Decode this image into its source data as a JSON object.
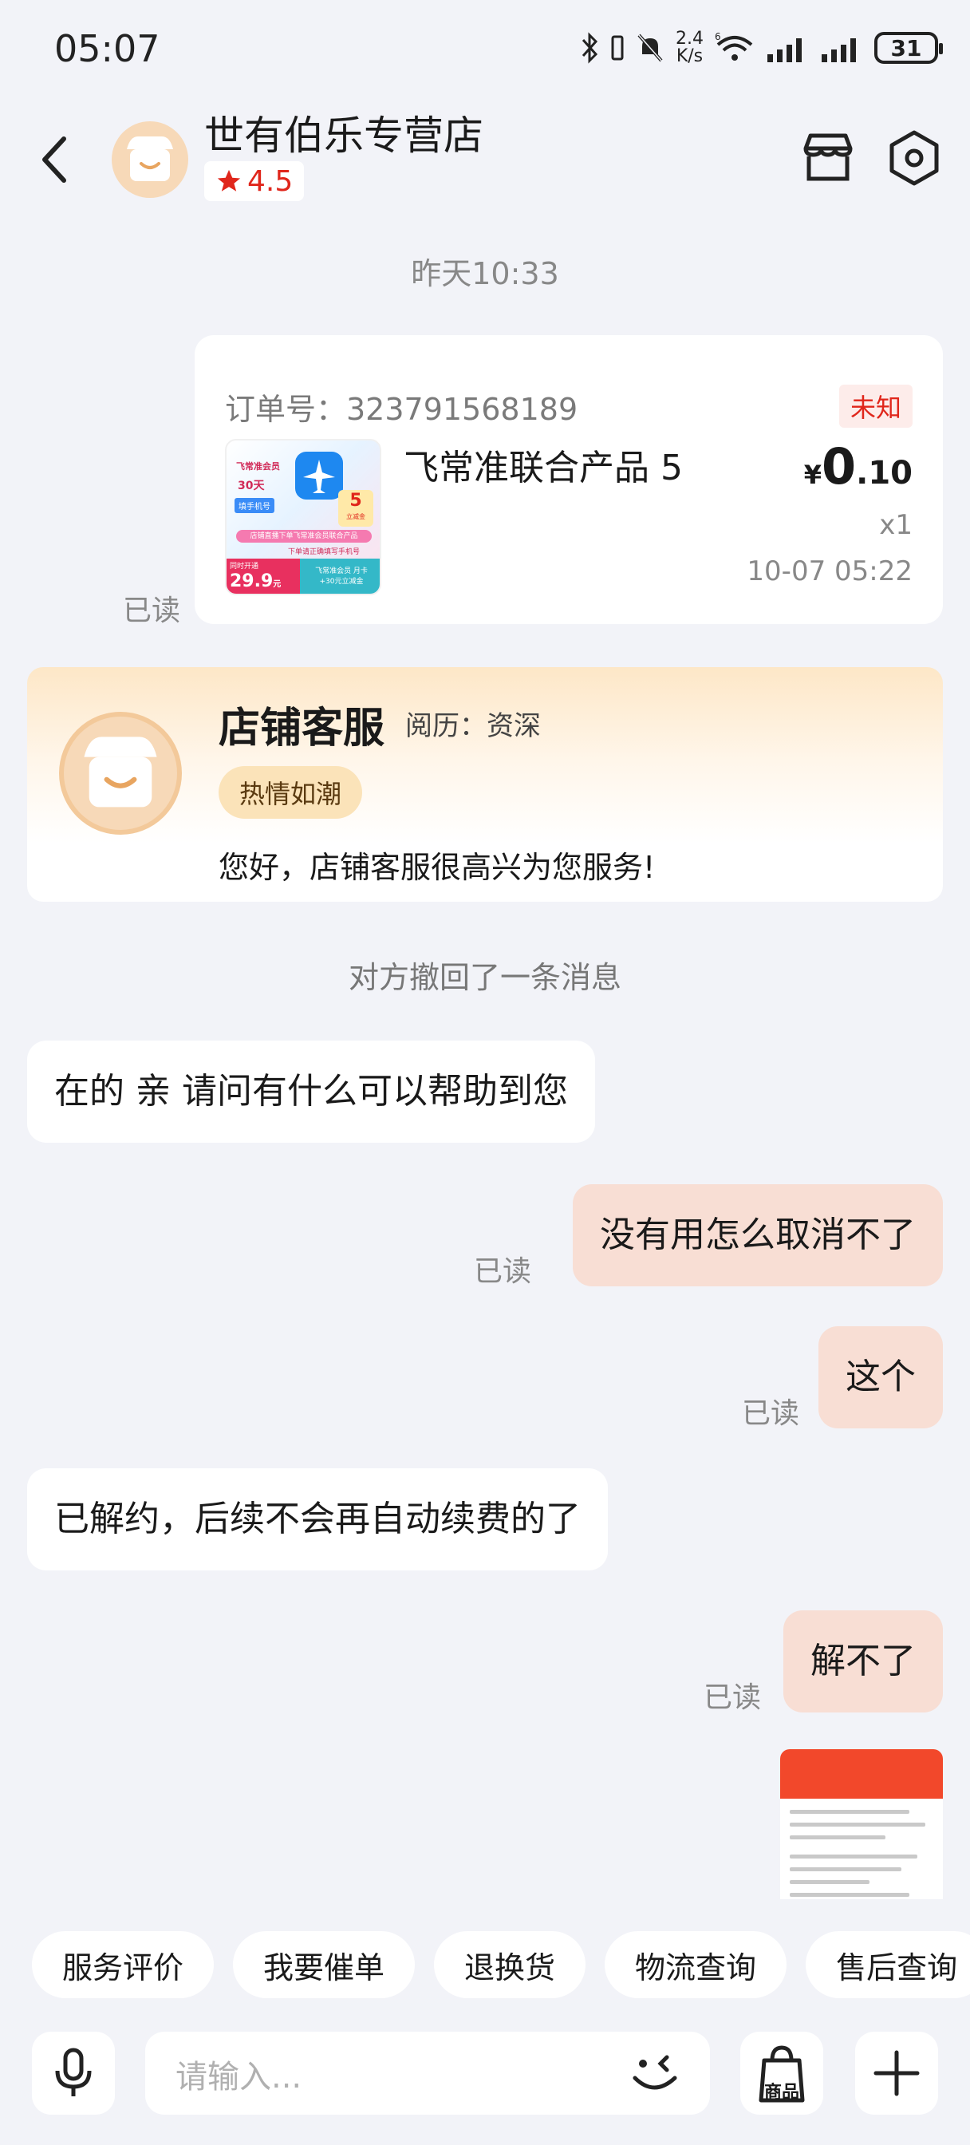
{
  "status_bar": {
    "time": "05:07",
    "net_speed_top": "2.4",
    "net_speed_bottom": "K/s",
    "battery": "31",
    "icons": [
      "bluetooth-icon",
      "vibrate-icon",
      "mute-bell-icon",
      "wifi-6-icon",
      "signal-icon",
      "signal-icon",
      "battery-icon"
    ]
  },
  "header": {
    "shop_name": "世有伯乐专营店",
    "rating": "4.5"
  },
  "chat": {
    "time_separator": "昨天10:33",
    "order_card": {
      "order_no": "订单号：323791568189",
      "status": "未知",
      "product": "飞常准联合产品 5",
      "price_currency": "¥",
      "price_int": "0",
      "price_dec": ".10",
      "quantity": "x1",
      "date": "10-07 05:22",
      "read_label": "已读",
      "thumb": {
        "brand": "飞常准会员",
        "days": "30天",
        "tag": "填手机号",
        "badge": "5",
        "badge_sub": "立减金",
        "strip1": "店铺直播下单飞常准会员联合产品",
        "strip2": "下单请正确填写手机号",
        "promo_label": "同时开通",
        "price": "29.9",
        "price_unit": "元",
        "bottom1": "飞常准会员 月卡",
        "bottom2": "+30元立减金"
      }
    },
    "service_card": {
      "name": "店铺客服",
      "experience": "阅历：资深",
      "tag": "热情如潮",
      "greeting": "您好，店铺客服很高兴为您服务!"
    },
    "recall_notice": "对方撤回了一条消息",
    "messages": [
      {
        "side": "left",
        "text": "在的 亲 请问有什么可以帮助到您"
      },
      {
        "side": "right",
        "text": "没有用怎么取消不了",
        "read": "已读"
      },
      {
        "side": "right",
        "text": "这个",
        "read": "已读"
      },
      {
        "side": "left",
        "text": "已解约，后续不会再自动续费的了"
      },
      {
        "side": "right",
        "text": "解不了",
        "read": "已读"
      }
    ]
  },
  "quick_actions": [
    "服务评价",
    "我要催单",
    "退换货",
    "物流查询",
    "售后查询"
  ],
  "input_bar": {
    "placeholder": "请输入...",
    "goods_label": "商品"
  },
  "colors": {
    "accent_red": "#e0261b",
    "sent_bubble": "#f8ded4",
    "background": "#f2f3f8",
    "avatar_bg": "#f7d9b8"
  }
}
